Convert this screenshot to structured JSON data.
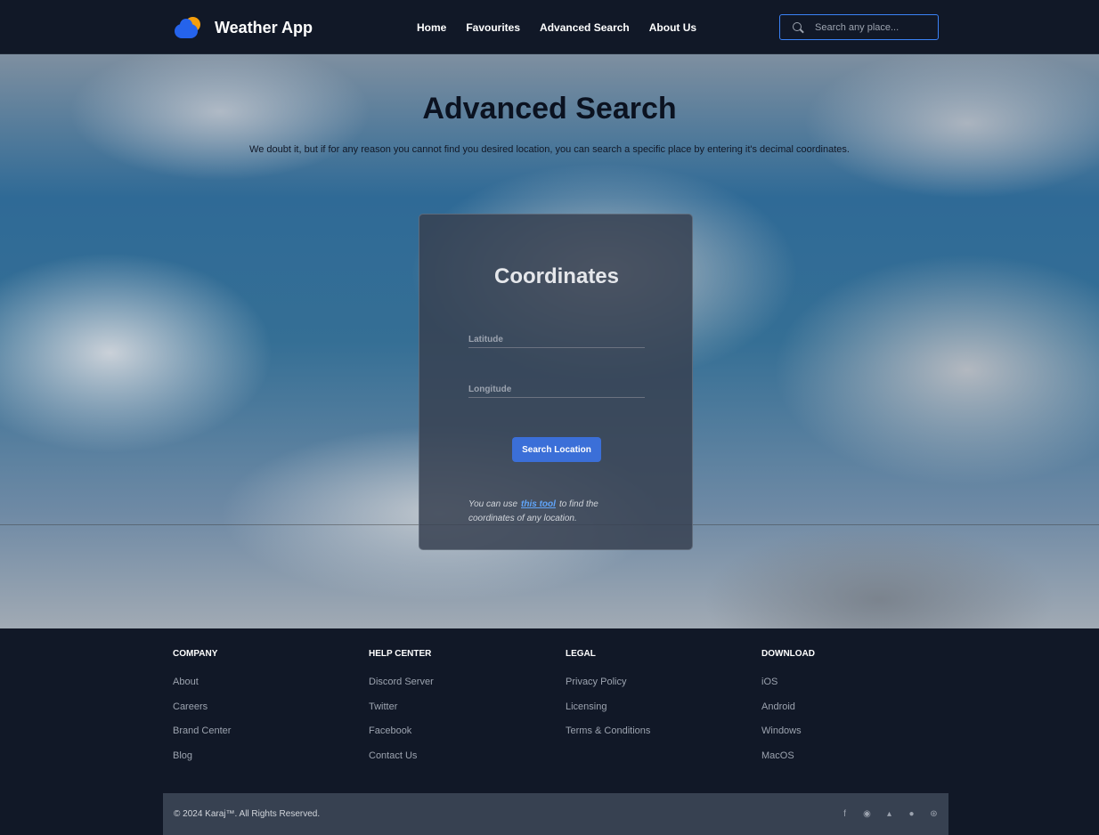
{
  "header": {
    "app_name": "Weather App",
    "nav": [
      "Home",
      "Favourites",
      "Advanced Search",
      "About Us"
    ],
    "search_placeholder": "Search any place..."
  },
  "hero": {
    "title": "Advanced Search",
    "subtitle": "We doubt it, but if for any reason you cannot find you desired location, you can search a specific place by entering it's decimal coordinates."
  },
  "card": {
    "title": "Coordinates",
    "latitude_placeholder": "Latitude",
    "longitude_placeholder": "Longitude",
    "button_label": "Search Location",
    "note_prefix": "You can use",
    "note_link": "this tool",
    "note_suffix": "to find the coordinates of any location."
  },
  "footer": {
    "columns": [
      {
        "title": "COMPANY",
        "links": [
          "About",
          "Careers",
          "Brand Center",
          "Blog"
        ]
      },
      {
        "title": "HELP CENTER",
        "links": [
          "Discord Server",
          "Twitter",
          "Facebook",
          "Contact Us"
        ]
      },
      {
        "title": "LEGAL",
        "links": [
          "Privacy Policy",
          "Licensing",
          "Terms & Conditions"
        ]
      },
      {
        "title": "DOWNLOAD",
        "links": [
          "iOS",
          "Android",
          "Windows",
          "MacOS"
        ]
      }
    ],
    "copyright": "© 2024 Karaj™. All Rights Reserved.",
    "socials": [
      "facebook-icon",
      "discord-icon",
      "twitter-icon",
      "github-icon",
      "dribbble-icon"
    ]
  },
  "colors": {
    "header_bg": "#111827",
    "accent": "#3b82f6",
    "button": "#3b6fd8",
    "card_bg": "#374151"
  }
}
